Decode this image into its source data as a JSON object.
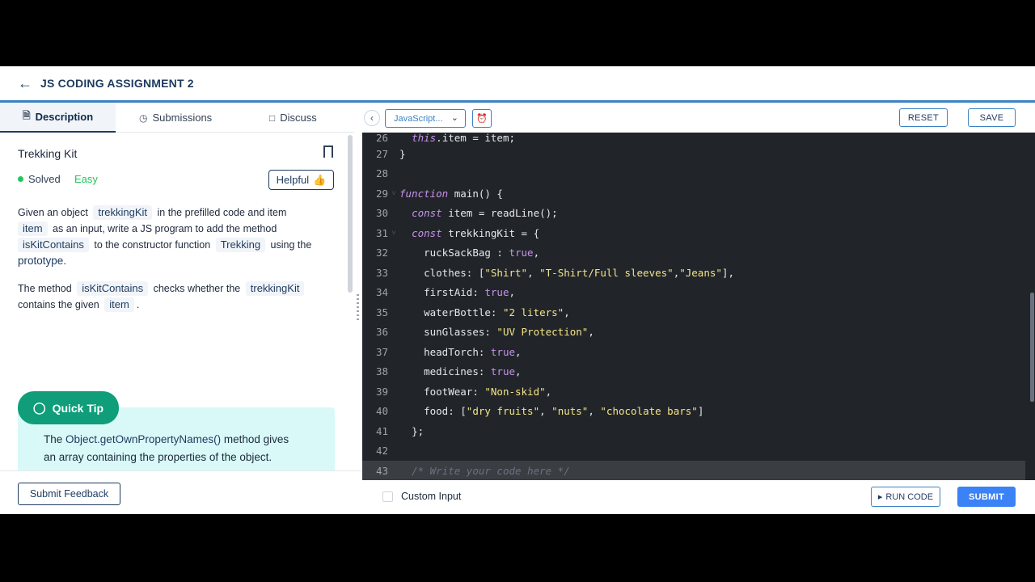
{
  "header": {
    "back_icon": "arrow-left-icon",
    "title": "JS CODING ASSIGNMENT 2"
  },
  "tabs": [
    {
      "label": "Description",
      "icon": "document-icon"
    },
    {
      "label": "Submissions",
      "icon": "clock-icon"
    },
    {
      "label": "Discuss",
      "icon": "chat-icon"
    }
  ],
  "problem": {
    "title": "Trekking Kit",
    "status": "Solved",
    "difficulty": "Easy",
    "helpful_label": "Helpful",
    "p1": {
      "t1": "Given an object",
      "c1": "trekkingKit",
      "t2": "in the prefilled code and item",
      "c2": "item",
      "t3": "as an input, write a JS program to add the method",
      "c3": "isKitContains",
      "t4": "to the constructor function",
      "c4": "Trekking",
      "t5": "using the",
      "t6": "prototype."
    },
    "p2": {
      "t1": "The method",
      "c1": "isKitContains",
      "t2": "checks whether the",
      "c2": "trekkingKit",
      "t3": "contains the given",
      "c3": "item",
      "t4": "."
    },
    "tip": {
      "label": "Quick Tip",
      "t1": "The",
      "method": "Object.getOwnPropertyNames()",
      "t2": "method gives an array containing the properties of the object."
    }
  },
  "footer_left": {
    "feedback_label": "Submit Feedback"
  },
  "toolbar": {
    "collapse_icon": "chevron-left-icon",
    "language": "JavaScript...",
    "alarm_icon": "alarm-clock-icon",
    "reset_label": "RESET",
    "save_label": "SAVE"
  },
  "editor": {
    "line_26": {
      "num": "26",
      "a": "this",
      "b": ".item = item;"
    },
    "line_27": {
      "num": "27",
      "a": "}"
    },
    "line_28": {
      "num": "28"
    },
    "line_29": {
      "num": "29",
      "kw": "function",
      "b": " main() {"
    },
    "line_30": {
      "num": "30",
      "kw": "const",
      "b": " item = readLine();"
    },
    "line_31": {
      "num": "31",
      "kw": "const",
      "b": " trekkingKit = {"
    },
    "line_32": {
      "num": "32",
      "a": "ruckSackBag : ",
      "v": "true",
      "c": ","
    },
    "line_33": {
      "num": "33",
      "a": "clothes: [",
      "s1": "\"Shirt\"",
      "b": ", ",
      "s2": "\"T-Shirt/Full sleeves\"",
      "c": ",",
      "s3": "\"Jeans\"",
      "d": "],"
    },
    "line_34": {
      "num": "34",
      "a": "firstAid: ",
      "v": "true",
      "c": ","
    },
    "line_35": {
      "num": "35",
      "a": "waterBottle: ",
      "s": "\"2 liters\"",
      "c": ","
    },
    "line_36": {
      "num": "36",
      "a": "sunGlasses: ",
      "s": "\"UV Protection\"",
      "c": ","
    },
    "line_37": {
      "num": "37",
      "a": "headTorch: ",
      "v": "true",
      "c": ","
    },
    "line_38": {
      "num": "38",
      "a": "medicines: ",
      "v": "true",
      "c": ","
    },
    "line_39": {
      "num": "39",
      "a": "footWear: ",
      "s": "\"Non-skid\"",
      "c": ","
    },
    "line_40": {
      "num": "40",
      "a": "food: [",
      "s1": "\"dry fruits\"",
      "b": ", ",
      "s2": "\"nuts\"",
      "c": ", ",
      "s3": "\"chocolate bars\"",
      "d": "]"
    },
    "line_41": {
      "num": "41",
      "a": "};"
    },
    "line_42": {
      "num": "42"
    },
    "line_43": {
      "num": "43",
      "cmt": "/* Write your code here */"
    }
  },
  "footer_right": {
    "custom_input_label": "Custom Input",
    "run_label": "RUN CODE",
    "submit_label": "SUBMIT"
  }
}
